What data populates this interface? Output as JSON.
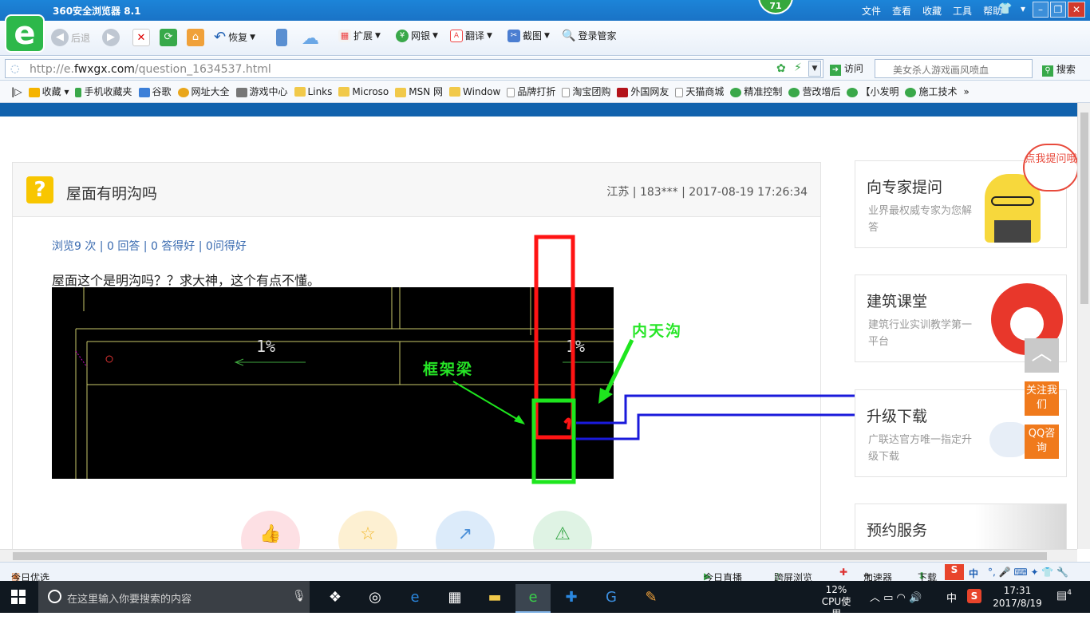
{
  "browser": {
    "title": "360安全浏览器 8.1",
    "badge": "71",
    "menus": [
      "文件",
      "查看",
      "收藏",
      "工具",
      "帮助"
    ],
    "back": "后退",
    "restore": "恢复",
    "extend": "扩展",
    "bank": "网银",
    "translate": "翻译",
    "screenshot": "截图",
    "login": "登录管家",
    "url_prefix": "http://e.",
    "url_domain": "fwxgx.com",
    "url_path": "/question_1634537.html",
    "visit": "访问",
    "search_placeholder": "美女杀人游戏画风喷血",
    "search_btn": "搜索"
  },
  "favorites": [
    "收藏",
    "手机收藏夹",
    "谷歌",
    "网址大全",
    "游戏中心",
    "Links",
    "Microso",
    "MSN 网",
    "Window",
    "品牌打折",
    "淘宝团购",
    "外国网友",
    "天猫商城",
    "精准控制",
    "营改增后",
    "【小发明",
    "施工技术"
  ],
  "question": {
    "title": "屋面有明沟吗",
    "meta": "江苏 | 183*** | 2017-08-19 17:26:34",
    "stats": "浏览9 次 | 0 回答 | 0 答得好 | 0问得好",
    "body": "屋面这个是明沟吗？？求大神，这个有点不懂。",
    "drawing": {
      "slope_left": "1%",
      "slope_right": "1%",
      "label_beam": "框架梁",
      "label_gutter": "内天沟"
    }
  },
  "sidebar": {
    "expert": {
      "title": "向专家提问",
      "sub": "业界最权威专家为您解答",
      "bubble": "点我提问哦"
    },
    "course": {
      "title": "建筑课堂",
      "sub": "建筑行业实训教学第一平台"
    },
    "upgrade": {
      "title": "升级下载",
      "sub": "广联达官方唯一指定升级下载"
    },
    "service": {
      "title": "预约服务"
    },
    "to_top": "︿",
    "follow": "关注我们",
    "qq": "QQ咨询"
  },
  "statusbar": {
    "today": "今日优选",
    "live": "今日直播",
    "crossscreen": "跨屏浏览",
    "accelerate": "加速器",
    "download": "下载",
    "ime": "中"
  },
  "taskbar": {
    "search": "在这里输入你要搜索的内容",
    "cpu_pct": "12%",
    "cpu_label": "CPU使用",
    "lang": "中",
    "time": "17:31",
    "date": "2017/8/19",
    "notif": "4"
  },
  "colors": {
    "titlebar": "#1a73c6",
    "green360": "#2db84a",
    "orange": "#f07a1c",
    "linkblue": "#3a6bb0"
  }
}
